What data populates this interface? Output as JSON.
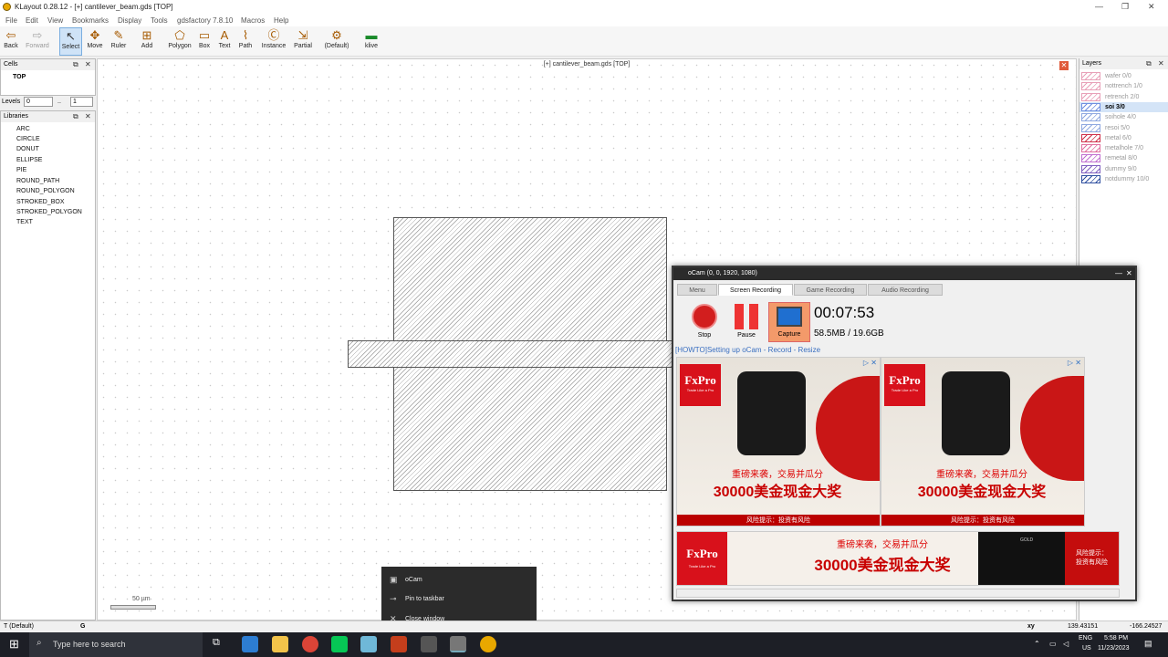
{
  "window": {
    "title": "KLayout 0.28.12 - [+] cantilever_beam.gds [TOP]"
  },
  "menu": [
    "File",
    "Edit",
    "View",
    "Bookmarks",
    "Display",
    "Tools",
    "gdsfactory 7.8.10",
    "Macros",
    "Help"
  ],
  "toolbar": [
    {
      "label": "Back",
      "icon": "back-arrow-icon"
    },
    {
      "label": "Forward",
      "icon": "forward-arrow-icon"
    },
    {
      "label": "Select",
      "icon": "select-cursor-icon"
    },
    {
      "label": "Move",
      "icon": "move-icon"
    },
    {
      "label": "Ruler",
      "icon": "ruler-icon"
    },
    {
      "label": "Add",
      "icon": "add-icon"
    },
    {
      "label": "Polygon",
      "icon": "polygon-icon"
    },
    {
      "label": "Box",
      "icon": "box-icon"
    },
    {
      "label": "Text",
      "icon": "text-icon"
    },
    {
      "label": "Path",
      "icon": "path-icon"
    },
    {
      "label": "Instance",
      "icon": "instance-icon"
    },
    {
      "label": "Partial",
      "icon": "partial-icon"
    },
    {
      "label": "(Default)",
      "icon": "default-mode-icon"
    },
    {
      "label": "klive",
      "icon": "klive-icon"
    }
  ],
  "cells": {
    "title": "Cells",
    "top": "TOP"
  },
  "levels": {
    "label": "Levels",
    "from": "0",
    "sep": "..",
    "to": "1"
  },
  "libraries": {
    "title": "Libraries",
    "items": [
      "ARC",
      "CIRCLE",
      "DONUT",
      "ELLIPSE",
      "PIE",
      "ROUND_PATH",
      "ROUND_POLYGON",
      "STROKED_BOX",
      "STROKED_POLYGON",
      "TEXT"
    ]
  },
  "canvas": {
    "title": "[+] cantilever_beam.gds [TOP]",
    "scale": "50 µm"
  },
  "layers": {
    "title": "Layers",
    "items": [
      {
        "name": "wafer 0/0",
        "color": "#e8a0b8"
      },
      {
        "name": "nottrench 1/0",
        "color": "#e8a0b8"
      },
      {
        "name": "retrench 2/0",
        "color": "#e8a0b8"
      },
      {
        "name": "soi 3/0",
        "color": "#6f8fe0",
        "selected": true
      },
      {
        "name": "soihole 4/0",
        "color": "#8fa8e0"
      },
      {
        "name": "resoi 5/0",
        "color": "#8fa8e0"
      },
      {
        "name": "metal 6/0",
        "color": "#d0304a"
      },
      {
        "name": "metalhole 7/0",
        "color": "#e070a0"
      },
      {
        "name": "remetal 8/0",
        "color": "#c070d0"
      },
      {
        "name": "dummy 9/0",
        "color": "#8060c0"
      },
      {
        "name": "notdummy 10/0",
        "color": "#3050a0"
      }
    ]
  },
  "status": {
    "mode": "T (Default)",
    "g": "G",
    "xy": "xy",
    "x": "139.43151",
    "y": "-166.24527"
  },
  "ocam": {
    "title": "oCam (0, 0, 1920, 1080)",
    "tabs": [
      "Menu",
      "Screen Recording",
      "Game Recording",
      "Audio Recording"
    ],
    "stop": "Stop",
    "pause": "Pause",
    "capture": "Capture",
    "timer": "00:07:53",
    "size": "58.5MB / 19.6GB",
    "link": "[HOWTO]Setting up oCam - Record - Resize",
    "ad": {
      "brand": "FxPro",
      "tagline": "Trade Like a Pro",
      "line1": "重磅来袭，交易并瓜分",
      "line2": "30000美金现金大奖",
      "risk": "风险提示：投资有风险",
      "risk2": "风险提示：\n投资有风险",
      "gold": "GOLD"
    }
  },
  "context_menu": [
    "oCam",
    "Pin to taskbar",
    "Close window"
  ],
  "taskbar": {
    "search": "Type here to search",
    "lang": "ENG",
    "region": "US",
    "time": "5:58 PM",
    "date": "11/23/2023"
  }
}
